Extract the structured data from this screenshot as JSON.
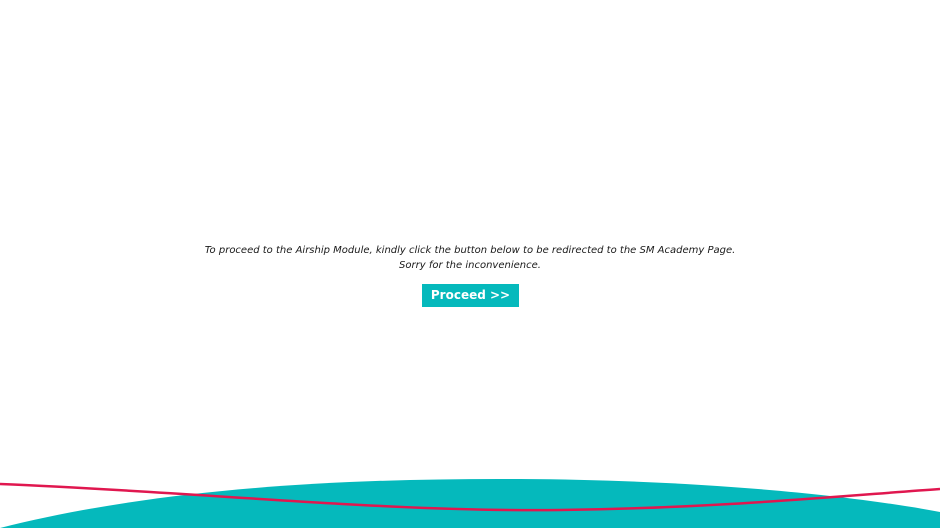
{
  "message": {
    "line1": "To proceed to the Airship Module, kindly click the button below to be redirected to the SM Academy Page.",
    "line2": "Sorry for the inconvenience."
  },
  "button": {
    "label": "Proceed >>"
  },
  "colors": {
    "accent": "#05b9bc",
    "wave_line": "#e0174f",
    "background": "#ffffff"
  }
}
